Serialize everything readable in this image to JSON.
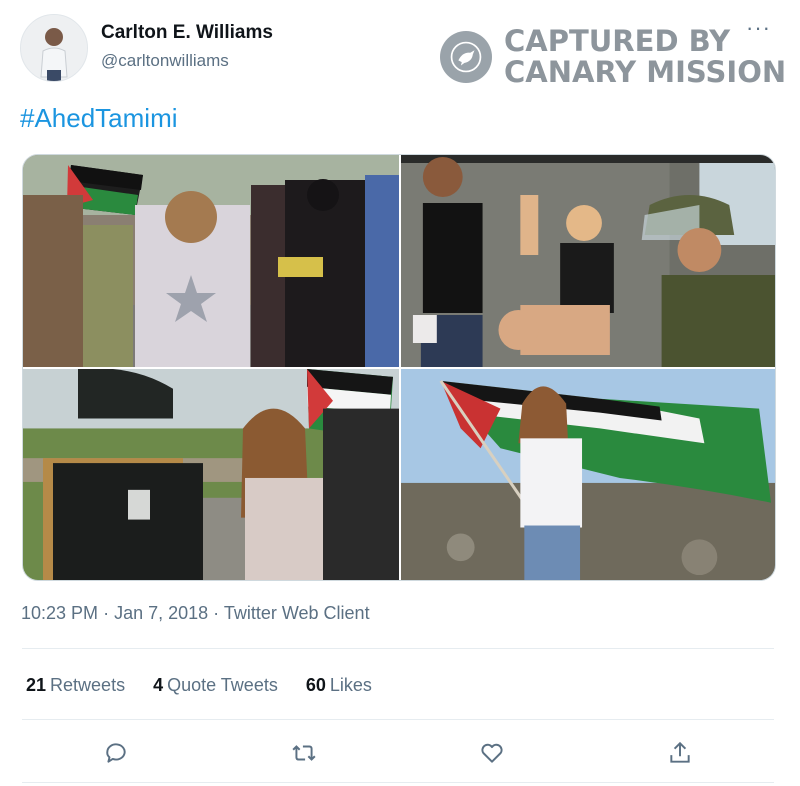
{
  "tweet": {
    "author": {
      "name": "Carlton E. Williams",
      "handle": "@carltonwilliams",
      "avatar_icon": "person-avatar"
    },
    "hashtag": "#AhedTamimi",
    "media": [
      {
        "icon": "photo-protest-march"
      },
      {
        "icon": "photo-children-soldier"
      },
      {
        "icon": "photo-girl-soldier-confrontation"
      },
      {
        "icon": "photo-girl-waving-flag"
      }
    ],
    "time": "10:23 PM",
    "separator": "·",
    "date": "Jan 7, 2018",
    "client": "Twitter Web Client",
    "stats": {
      "retweets_count": "21",
      "retweets_label": "Retweets",
      "quotes_count": "4",
      "quotes_label": "Quote Tweets",
      "likes_count": "60",
      "likes_label": "Likes"
    },
    "more": "···"
  },
  "watermark": {
    "line1": "CAPTURED BY",
    "line2": "CANARY MISSION",
    "icon": "canary-bird-icon"
  },
  "actions": [
    {
      "name": "reply",
      "icon": "reply-icon"
    },
    {
      "name": "retweet",
      "icon": "retweet-icon"
    },
    {
      "name": "like",
      "icon": "heart-icon"
    },
    {
      "name": "share",
      "icon": "share-icon"
    }
  ],
  "colors": {
    "link": "#1b95e0",
    "secondary_text": "#5b7083",
    "primary_text": "#0f1419",
    "divider": "#e6ecf0"
  }
}
